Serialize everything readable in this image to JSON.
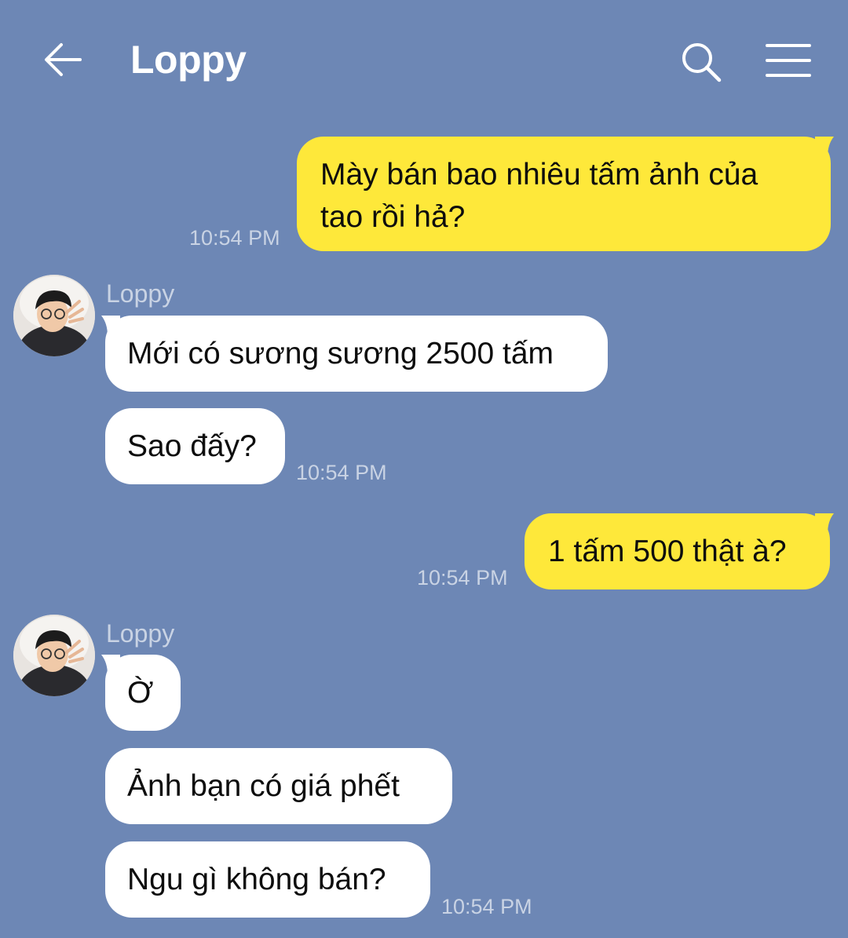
{
  "header": {
    "title": "Loppy",
    "back_icon": "arrow-left-icon",
    "search_icon": "search-icon",
    "menu_icon": "hamburger-menu-icon"
  },
  "colors": {
    "background": "#6d87b5",
    "my_bubble": "#fee83a",
    "their_bubble": "#ffffff",
    "meta_text": "#c9d3e4"
  },
  "messages": [
    {
      "from": "me",
      "text": "Mày bán bao nhiêu tấm ảnh của tao rồi hả?",
      "time": "10:54 PM"
    },
    {
      "from": "them",
      "sender": "Loppy",
      "text": "Mới có sương sương 2500 tấm"
    },
    {
      "from": "them",
      "text": "Sao đấy?",
      "time": "10:54 PM"
    },
    {
      "from": "me",
      "text": "1 tấm 500 thật à?",
      "time": "10:54 PM"
    },
    {
      "from": "them",
      "sender": "Loppy",
      "text": "Ờ"
    },
    {
      "from": "them",
      "text": "Ảnh bạn có giá phết"
    },
    {
      "from": "them",
      "text": "Ngu gì không bán?",
      "time": "10:54 PM"
    }
  ]
}
